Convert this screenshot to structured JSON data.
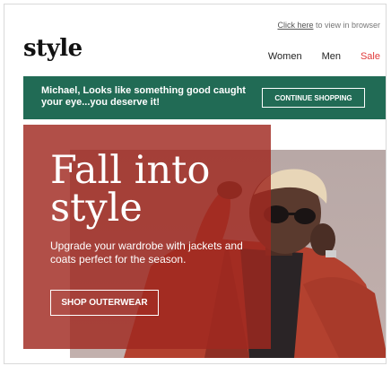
{
  "header": {
    "view_link": "Click here",
    "view_suffix": " to view in browser",
    "logo": "style",
    "nav": [
      "Women",
      "Men",
      "Sale"
    ]
  },
  "banner": {
    "message": "Michael, Looks like something good caught your eye...you deserve it!",
    "button": "CONTINUE SHOPPING",
    "bg_color": "#216b55"
  },
  "hero": {
    "title": "Fall into\nstyle",
    "subtitle": "Upgrade your wardrobe with jackets and coats perfect for the season.",
    "button": "SHOP OUTERWEAR",
    "overlay_color": "#a02820"
  },
  "colors": {
    "sale": "#e03a3a"
  }
}
